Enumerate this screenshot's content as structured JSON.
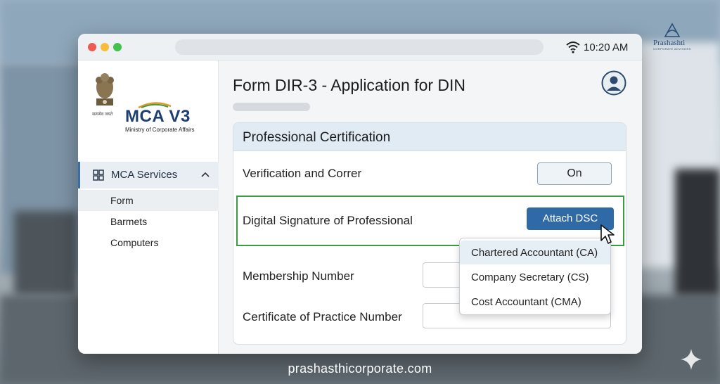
{
  "status": {
    "time": "10:20 AM"
  },
  "brand": {
    "name": "Prashashti",
    "tagline": "CORPORATE ADVISORS",
    "website": "prashasthicorporate.com"
  },
  "sidebar": {
    "logo_text": "MCA V3",
    "logo_subtitle": "Ministry of Corporate Affairs",
    "emblem_caption": "सत्यमेव जयते",
    "services_label": "MCA Services",
    "items": [
      {
        "label": "Form",
        "active": true
      },
      {
        "label": "Barmets",
        "active": false
      },
      {
        "label": "Computers",
        "active": false
      }
    ]
  },
  "main": {
    "title": "Form DIR-3 - Application for DIN",
    "card": {
      "header": "Professional Certification",
      "verification_label": "Verification and Correr",
      "verification_button": "On",
      "dsc_label": "Digital Signature of Professional",
      "dsc_button": "Attach DSC",
      "membership_label": "Membership Number",
      "membership_value": "",
      "certificate_label": "Certificate of Practice Number",
      "certificate_value": ""
    }
  },
  "dropdown": {
    "options": [
      "Chartered Accountant (CA)",
      "Company Secretary (CS)",
      "Cost Accountant (CMA)"
    ],
    "highlighted_index": 0
  },
  "colors": {
    "accent": "#2f6aa7",
    "highlight_border": "#3a9d43",
    "header_bg": "#e1ebf4"
  },
  "icons": [
    "wifi-icon",
    "grid-icon",
    "chevron-up-icon",
    "user-avatar-icon",
    "mouse-cursor-icon",
    "sparkle-icon"
  ]
}
